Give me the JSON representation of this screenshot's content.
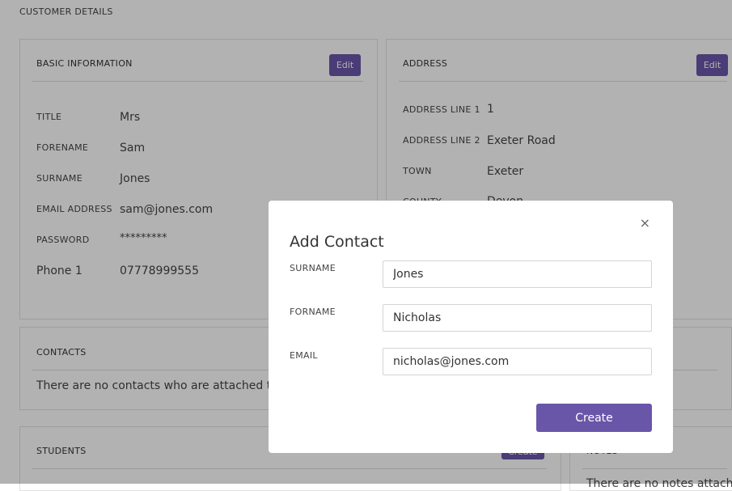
{
  "page": {
    "title": "CUSTOMER DETAILS"
  },
  "basic": {
    "title": "BASIC INFORMATION",
    "edit_label": "Edit",
    "fields": [
      {
        "label": "TITLE",
        "value": "Mrs"
      },
      {
        "label": "FORENAME",
        "value": "Sam"
      },
      {
        "label": "SURNAME",
        "value": "Jones"
      },
      {
        "label": "EMAIL ADDRESS",
        "value": "sam@jones.com"
      },
      {
        "label": "PASSWORD",
        "value": "*********"
      },
      {
        "label": "Phone 1",
        "value": "07778999555"
      }
    ]
  },
  "address": {
    "title": "ADDRESS",
    "edit_label": "Edit",
    "fields": [
      {
        "label": "ADDRESS LINE 1",
        "value": "1"
      },
      {
        "label": "ADDRESS LINE 2",
        "value": "Exeter Road"
      },
      {
        "label": "TOWN",
        "value": "Exeter"
      },
      {
        "label": "COUNTY",
        "value": "Devon"
      }
    ]
  },
  "contacts": {
    "title": "CONTACTS",
    "empty_text": "There are no contacts who are attached to thi"
  },
  "students": {
    "title": "STUDENTS",
    "create_label": "Create"
  },
  "notes": {
    "title": "NOTES",
    "empty_text": "There are no notes attached"
  },
  "modal": {
    "title": "Add Contact",
    "close_glyph": "×",
    "fields": [
      {
        "label": "SURNAME",
        "value": "Jones"
      },
      {
        "label": "FORNAME",
        "value": "Nicholas"
      },
      {
        "label": "EMAIL",
        "value": "nicholas@jones.com"
      }
    ],
    "create_label": "Create"
  },
  "colors": {
    "accent": "#6a56a9",
    "overlay": "rgba(0,0,0,0.30)"
  }
}
